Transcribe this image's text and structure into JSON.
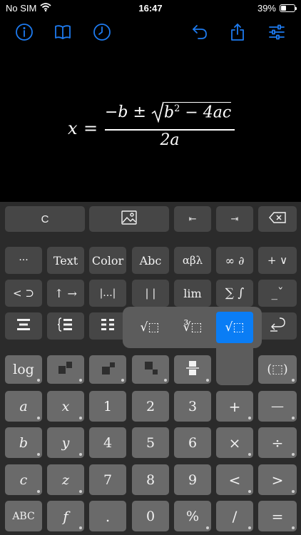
{
  "status_bar": {
    "carrier": "No SIM",
    "time": "16:47",
    "battery_text": "39%",
    "battery_level": 0.39
  },
  "toolbar": {
    "icons": [
      "info-icon",
      "book-icon",
      "history-clock-icon",
      "undo-icon",
      "share-icon",
      "settings-sliders-icon"
    ],
    "accent_color": "#1e7bf0"
  },
  "equation": {
    "lhs": "x",
    "equals": "=",
    "num_minus_b": "−b",
    "num_pm": "±",
    "num_b": "b",
    "num_exp": "2",
    "num_minus": "−",
    "num_4ac": "4ac",
    "den": "2a"
  },
  "keyboard": {
    "row0": {
      "clear": "C",
      "image": "image-icon",
      "start": "⇤",
      "end": "⇥",
      "backspace": "delete-left-icon"
    },
    "row1": [
      "···",
      "Text",
      "Color",
      "Abc",
      "αβλ",
      "∞ ∂",
      "+ ∨"
    ],
    "row2": [
      "< ⊃",
      "↑ →",
      "|...|",
      "| |",
      "lim",
      "∑ ∫",
      "_ˇ"
    ],
    "row3_icons": [
      "align-center-icon",
      "brace-cases-icon",
      "matrix-icon",
      "return-icon"
    ],
    "row4": {
      "log": "log",
      "paren": "(⬚)"
    },
    "row5": [
      "a",
      "x",
      "1",
      "2",
      "3",
      "+",
      "—"
    ],
    "row6": [
      "b",
      "y",
      "4",
      "5",
      "6",
      "×",
      "÷"
    ],
    "row7": [
      "c",
      "z",
      "7",
      "8",
      "9",
      "<",
      ">"
    ],
    "row8": [
      "ABC",
      "f",
      ".",
      "0",
      "%",
      "/",
      "="
    ]
  },
  "popup": {
    "options": [
      "√⬚",
      "∛⬚",
      "√⬚"
    ],
    "selected_index": 2,
    "selected_color": "#0a7df5"
  }
}
